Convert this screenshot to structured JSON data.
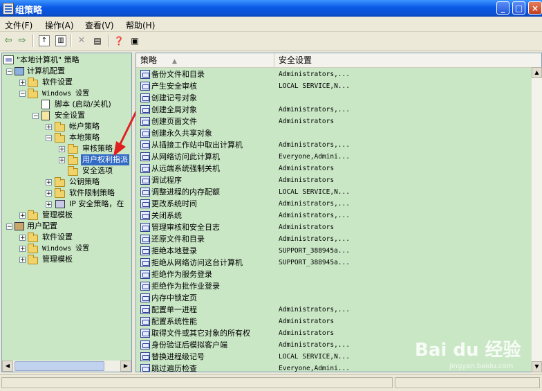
{
  "window": {
    "title": "组策略"
  },
  "menu": [
    "文件(F)",
    "操作(A)",
    "查看(V)",
    "帮助(H)"
  ],
  "tree": {
    "root": "\"本地计算机\" 策略",
    "items": [
      {
        "label": "计算机配置"
      },
      {
        "label": "软件设置"
      },
      {
        "label": "Windows 设置"
      },
      {
        "label": "脚本 (启动/关机)"
      },
      {
        "label": "安全设置"
      },
      {
        "label": "帐户策略"
      },
      {
        "label": "本地策略"
      },
      {
        "label": "审核策略"
      },
      {
        "label": "用户权利指派"
      },
      {
        "label": "安全选项"
      },
      {
        "label": "公钥策略"
      },
      {
        "label": "软件限制策略"
      },
      {
        "label": "IP 安全策略，在"
      },
      {
        "label": "管理模板"
      },
      {
        "label": "用户配置"
      },
      {
        "label": "软件设置"
      },
      {
        "label": "Windows 设置"
      },
      {
        "label": "管理模板"
      }
    ]
  },
  "list": {
    "columns": [
      "策略",
      "安全设置"
    ],
    "rows": [
      {
        "name": "备份文件和目录",
        "value": "Administrators,..."
      },
      {
        "name": "产生安全审核",
        "value": "LOCAL SERVICE,N..."
      },
      {
        "name": "创建记号对象",
        "value": ""
      },
      {
        "name": "创建全局对象",
        "value": "Administrators,..."
      },
      {
        "name": "创建页面文件",
        "value": "Administrators"
      },
      {
        "name": "创建永久共享对象",
        "value": ""
      },
      {
        "name": "从插接工作站中取出计算机",
        "value": "Administrators,..."
      },
      {
        "name": "从网络访问此计算机",
        "value": "Everyone,Admini..."
      },
      {
        "name": "从远端系统强制关机",
        "value": "Administrators"
      },
      {
        "name": "调试程序",
        "value": "Administrators"
      },
      {
        "name": "调整进程的内存配额",
        "value": "LOCAL SERVICE,N..."
      },
      {
        "name": "更改系统时间",
        "value": "Administrators,..."
      },
      {
        "name": "关闭系统",
        "value": "Administrators,..."
      },
      {
        "name": "管理审核和安全日志",
        "value": "Administrators"
      },
      {
        "name": "还原文件和目录",
        "value": "Administrators,..."
      },
      {
        "name": "拒绝本地登录",
        "value": "SUPPORT_388945a..."
      },
      {
        "name": "拒绝从网络访问这台计算机",
        "value": "SUPPORT_388945a..."
      },
      {
        "name": "拒绝作为服务登录",
        "value": ""
      },
      {
        "name": "拒绝作为批作业登录",
        "value": ""
      },
      {
        "name": "内存中锁定页",
        "value": ""
      },
      {
        "name": "配置单一进程",
        "value": "Administrators,..."
      },
      {
        "name": "配置系统性能",
        "value": "Administrators"
      },
      {
        "name": "取得文件或其它对象的所有权",
        "value": "Administrators"
      },
      {
        "name": "身份验证后模拟客户端",
        "value": "Administrators,..."
      },
      {
        "name": "替换进程级记号",
        "value": "LOCAL SERVICE,N..."
      },
      {
        "name": "跳过遍历检查",
        "value": "Everyone,Admini..."
      }
    ]
  },
  "watermark": {
    "brand": "Bai du 经验",
    "url": "jingyan.baidu.com"
  },
  "colors": {
    "pane_bg": "#c9e7c5",
    "selection": "#316ac5",
    "arrow": "#e02020"
  }
}
